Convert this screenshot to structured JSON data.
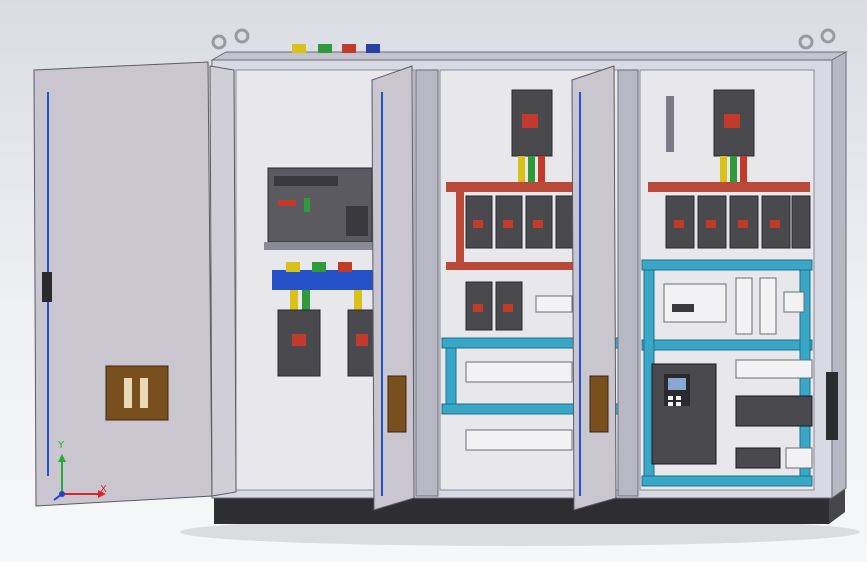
{
  "scene": {
    "subject": "electrical-control-cabinet-3d-model",
    "colors": {
      "cabinet_frame": "#d8d9e2",
      "door": "#c9c6d0",
      "back_panel": "#e8e8ec",
      "plinth": "#2e2e32",
      "busbar_red": "#b94a3a",
      "busbar_blue": "#2450c8",
      "cable_tray": "#39a7c8",
      "breaker_body": "#4a4a4e",
      "handle_brown": "#7a4f1e",
      "terminal_caps": [
        "#d8c21a",
        "#2f9a3a",
        "#c23a2a",
        "#2b3fa8"
      ]
    }
  },
  "axes": {
    "x_label": "X",
    "y_label": "Y",
    "colors": {
      "x": "#d8262a",
      "y": "#2aa83a",
      "z": "#2a3fc8"
    }
  }
}
